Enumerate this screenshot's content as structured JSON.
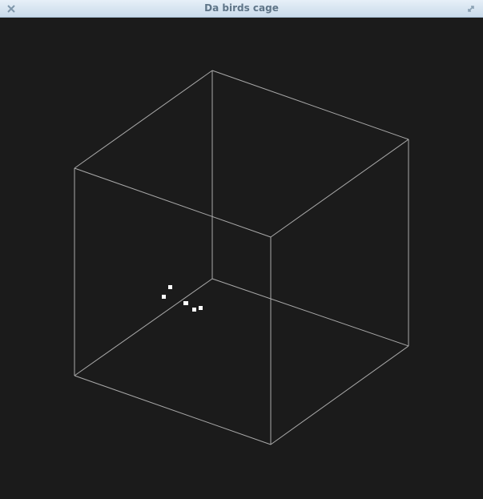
{
  "window": {
    "title": "Da birds cage",
    "close_icon": "close-icon",
    "maximize_icon": "maximize-icon"
  },
  "scene": {
    "background_color": "#1b1b1b",
    "cage_color": "#d9d9d9",
    "bird_color": "#ffffff",
    "bird_count": 5
  }
}
